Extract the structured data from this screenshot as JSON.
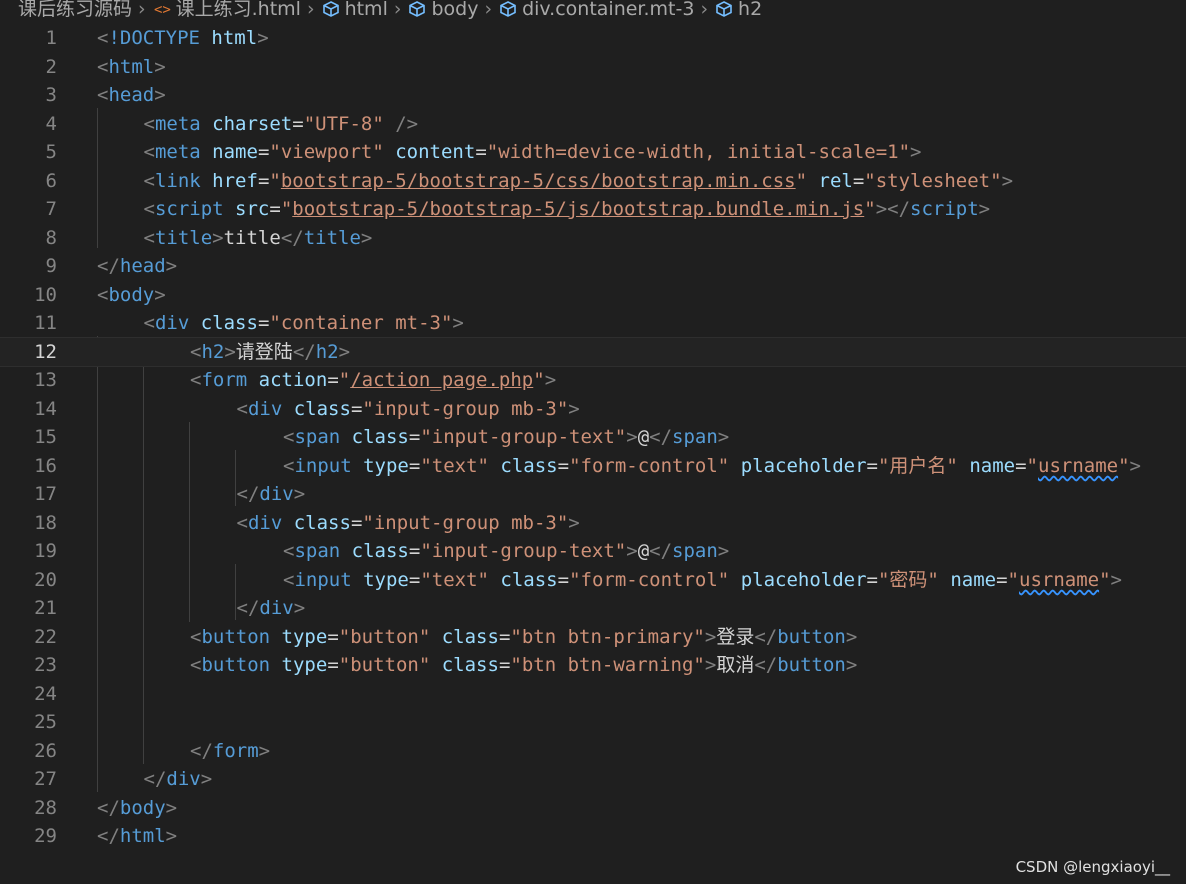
{
  "breadcrumb": [
    {
      "label": "课后练习源码",
      "icon": ""
    },
    {
      "label": "课上练习.html",
      "icon": "html-file-icon"
    },
    {
      "label": "html",
      "icon": "symbol-element-icon"
    },
    {
      "label": "body",
      "icon": "symbol-element-icon"
    },
    {
      "label": "div.container.mt-3",
      "icon": "symbol-element-icon"
    },
    {
      "label": "h2",
      "icon": "symbol-element-icon"
    }
  ],
  "editor": {
    "active_line": 12,
    "lines": [
      {
        "n": "1",
        "indent": 0,
        "tokens": [
          [
            "b",
            "<"
          ],
          [
            "t",
            "!DOCTYPE"
          ],
          [
            "x",
            " "
          ],
          [
            "a",
            "html"
          ],
          [
            "b",
            ">"
          ]
        ]
      },
      {
        "n": "2",
        "indent": 0,
        "tokens": [
          [
            "b",
            "<"
          ],
          [
            "t",
            "html"
          ],
          [
            "b",
            ">"
          ]
        ]
      },
      {
        "n": "3",
        "indent": 0,
        "tokens": [
          [
            "b",
            "<"
          ],
          [
            "t",
            "head"
          ],
          [
            "b",
            ">"
          ]
        ]
      },
      {
        "n": "4",
        "indent": 1,
        "tokens": [
          [
            "b",
            "<"
          ],
          [
            "t",
            "meta"
          ],
          [
            "x",
            " "
          ],
          [
            "a",
            "charset"
          ],
          [
            "x",
            "="
          ],
          [
            "s",
            "\"UTF-8\""
          ],
          [
            "x",
            " "
          ],
          [
            "b",
            "/>"
          ]
        ]
      },
      {
        "n": "5",
        "indent": 1,
        "tokens": [
          [
            "b",
            "<"
          ],
          [
            "t",
            "meta"
          ],
          [
            "x",
            " "
          ],
          [
            "a",
            "name"
          ],
          [
            "x",
            "="
          ],
          [
            "s",
            "\"viewport\""
          ],
          [
            "x",
            " "
          ],
          [
            "a",
            "content"
          ],
          [
            "x",
            "="
          ],
          [
            "s",
            "\"width=device-width, initial-scale=1\""
          ],
          [
            "b",
            ">"
          ]
        ]
      },
      {
        "n": "6",
        "indent": 1,
        "tokens": [
          [
            "b",
            "<"
          ],
          [
            "t",
            "link"
          ],
          [
            "x",
            " "
          ],
          [
            "a",
            "href"
          ],
          [
            "x",
            "="
          ],
          [
            "s",
            "\""
          ],
          [
            "sl",
            "bootstrap-5/bootstrap-5/css/bootstrap.min.css"
          ],
          [
            "s",
            "\""
          ],
          [
            "x",
            " "
          ],
          [
            "a",
            "rel"
          ],
          [
            "x",
            "="
          ],
          [
            "s",
            "\"stylesheet\""
          ],
          [
            "b",
            ">"
          ]
        ]
      },
      {
        "n": "7",
        "indent": 1,
        "tokens": [
          [
            "b",
            "<"
          ],
          [
            "t",
            "script"
          ],
          [
            "x",
            " "
          ],
          [
            "a",
            "src"
          ],
          [
            "x",
            "="
          ],
          [
            "s",
            "\""
          ],
          [
            "sl",
            "bootstrap-5/bootstrap-5/js/bootstrap.bundle.min.js"
          ],
          [
            "s",
            "\""
          ],
          [
            "b",
            "></"
          ],
          [
            "t",
            "script"
          ],
          [
            "b",
            ">"
          ]
        ]
      },
      {
        "n": "8",
        "indent": 1,
        "tokens": [
          [
            "b",
            "<"
          ],
          [
            "t",
            "title"
          ],
          [
            "b",
            ">"
          ],
          [
            "x",
            "title"
          ],
          [
            "b",
            "</"
          ],
          [
            "t",
            "title"
          ],
          [
            "b",
            ">"
          ]
        ]
      },
      {
        "n": "9",
        "indent": 0,
        "tokens": [
          [
            "b",
            "</"
          ],
          [
            "t",
            "head"
          ],
          [
            "b",
            ">"
          ]
        ]
      },
      {
        "n": "10",
        "indent": 0,
        "tokens": [
          [
            "b",
            "<"
          ],
          [
            "t",
            "body"
          ],
          [
            "b",
            ">"
          ]
        ]
      },
      {
        "n": "11",
        "indent": 1,
        "tokens": [
          [
            "b",
            "<"
          ],
          [
            "t",
            "div"
          ],
          [
            "x",
            " "
          ],
          [
            "a",
            "class"
          ],
          [
            "x",
            "="
          ],
          [
            "s",
            "\"container mt-3\""
          ],
          [
            "b",
            ">"
          ]
        ]
      },
      {
        "n": "12",
        "indent": 2,
        "tokens": [
          [
            "b",
            "<"
          ],
          [
            "t",
            "h2"
          ],
          [
            "b",
            ">"
          ],
          [
            "x",
            "请登陆"
          ],
          [
            "b",
            "</"
          ],
          [
            "t",
            "h2"
          ],
          [
            "b",
            ">"
          ]
        ]
      },
      {
        "n": "13",
        "indent": 2,
        "tokens": [
          [
            "b",
            "<"
          ],
          [
            "t",
            "form"
          ],
          [
            "x",
            " "
          ],
          [
            "a",
            "action"
          ],
          [
            "x",
            "="
          ],
          [
            "s",
            "\""
          ],
          [
            "sl",
            "/action_page.php"
          ],
          [
            "s",
            "\""
          ],
          [
            "b",
            ">"
          ]
        ]
      },
      {
        "n": "14",
        "indent": 3,
        "tokens": [
          [
            "b",
            "<"
          ],
          [
            "t",
            "div"
          ],
          [
            "x",
            " "
          ],
          [
            "a",
            "class"
          ],
          [
            "x",
            "="
          ],
          [
            "s",
            "\"input-group mb-3\""
          ],
          [
            "b",
            ">"
          ]
        ]
      },
      {
        "n": "15",
        "indent": 4,
        "tokens": [
          [
            "b",
            "<"
          ],
          [
            "t",
            "span"
          ],
          [
            "x",
            " "
          ],
          [
            "a",
            "class"
          ],
          [
            "x",
            "="
          ],
          [
            "s",
            "\"input-group-text\""
          ],
          [
            "b",
            ">"
          ],
          [
            "x",
            "@"
          ],
          [
            "b",
            "</"
          ],
          [
            "t",
            "span"
          ],
          [
            "b",
            ">"
          ]
        ]
      },
      {
        "n": "16",
        "indent": 4,
        "tokens": [
          [
            "b",
            "<"
          ],
          [
            "t",
            "input"
          ],
          [
            "x",
            " "
          ],
          [
            "a",
            "type"
          ],
          [
            "x",
            "="
          ],
          [
            "s",
            "\"text\""
          ],
          [
            "x",
            " "
          ],
          [
            "a",
            "class"
          ],
          [
            "x",
            "="
          ],
          [
            "s",
            "\"form-control\""
          ],
          [
            "x",
            " "
          ],
          [
            "a",
            "placeholder"
          ],
          [
            "x",
            "="
          ],
          [
            "s",
            "\"用户名\""
          ],
          [
            "x",
            " "
          ],
          [
            "a",
            "name"
          ],
          [
            "x",
            "="
          ],
          [
            "s",
            "\""
          ],
          [
            "sw",
            "usrname"
          ],
          [
            "s",
            "\""
          ],
          [
            "b",
            ">"
          ]
        ]
      },
      {
        "n": "17",
        "indent": 3,
        "tokens": [
          [
            "b",
            "</"
          ],
          [
            "t",
            "div"
          ],
          [
            "b",
            ">"
          ]
        ]
      },
      {
        "n": "18",
        "indent": 3,
        "tokens": [
          [
            "b",
            "<"
          ],
          [
            "t",
            "div"
          ],
          [
            "x",
            " "
          ],
          [
            "a",
            "class"
          ],
          [
            "x",
            "="
          ],
          [
            "s",
            "\"input-group mb-3\""
          ],
          [
            "b",
            ">"
          ]
        ]
      },
      {
        "n": "19",
        "indent": 4,
        "tokens": [
          [
            "b",
            "<"
          ],
          [
            "t",
            "span"
          ],
          [
            "x",
            " "
          ],
          [
            "a",
            "class"
          ],
          [
            "x",
            "="
          ],
          [
            "s",
            "\"input-group-text\""
          ],
          [
            "b",
            ">"
          ],
          [
            "x",
            "@"
          ],
          [
            "b",
            "</"
          ],
          [
            "t",
            "span"
          ],
          [
            "b",
            ">"
          ]
        ]
      },
      {
        "n": "20",
        "indent": 4,
        "tokens": [
          [
            "b",
            "<"
          ],
          [
            "t",
            "input"
          ],
          [
            "x",
            " "
          ],
          [
            "a",
            "type"
          ],
          [
            "x",
            "="
          ],
          [
            "s",
            "\"text\""
          ],
          [
            "x",
            " "
          ],
          [
            "a",
            "class"
          ],
          [
            "x",
            "="
          ],
          [
            "s",
            "\"form-control\""
          ],
          [
            "x",
            " "
          ],
          [
            "a",
            "placeholder"
          ],
          [
            "x",
            "="
          ],
          [
            "s",
            "\"密码\""
          ],
          [
            "x",
            " "
          ],
          [
            "a",
            "name"
          ],
          [
            "x",
            "="
          ],
          [
            "s",
            "\""
          ],
          [
            "sw",
            "usrname"
          ],
          [
            "s",
            "\""
          ],
          [
            "b",
            ">"
          ]
        ]
      },
      {
        "n": "21",
        "indent": 3,
        "tokens": [
          [
            "b",
            "</"
          ],
          [
            "t",
            "div"
          ],
          [
            "b",
            ">"
          ]
        ]
      },
      {
        "n": "22",
        "indent": 2,
        "tokens": [
          [
            "b",
            "<"
          ],
          [
            "t",
            "button"
          ],
          [
            "x",
            " "
          ],
          [
            "a",
            "type"
          ],
          [
            "x",
            "="
          ],
          [
            "s",
            "\"button\""
          ],
          [
            "x",
            " "
          ],
          [
            "a",
            "class"
          ],
          [
            "x",
            "="
          ],
          [
            "s",
            "\"btn btn-primary\""
          ],
          [
            "b",
            ">"
          ],
          [
            "x",
            "登录"
          ],
          [
            "b",
            "</"
          ],
          [
            "t",
            "button"
          ],
          [
            "b",
            ">"
          ]
        ]
      },
      {
        "n": "23",
        "indent": 2,
        "tokens": [
          [
            "b",
            "<"
          ],
          [
            "t",
            "button"
          ],
          [
            "x",
            " "
          ],
          [
            "a",
            "type"
          ],
          [
            "x",
            "="
          ],
          [
            "s",
            "\"button\""
          ],
          [
            "x",
            " "
          ],
          [
            "a",
            "class"
          ],
          [
            "x",
            "="
          ],
          [
            "s",
            "\"btn btn-warning\""
          ],
          [
            "b",
            ">"
          ],
          [
            "x",
            "取消"
          ],
          [
            "b",
            "</"
          ],
          [
            "t",
            "button"
          ],
          [
            "b",
            ">"
          ]
        ]
      },
      {
        "n": "24",
        "indent": 0,
        "tokens": []
      },
      {
        "n": "25",
        "indent": 0,
        "tokens": []
      },
      {
        "n": "26",
        "indent": 2,
        "tokens": [
          [
            "b",
            "</"
          ],
          [
            "t",
            "form"
          ],
          [
            "b",
            ">"
          ]
        ]
      },
      {
        "n": "27",
        "indent": 1,
        "tokens": [
          [
            "b",
            "</"
          ],
          [
            "t",
            "div"
          ],
          [
            "b",
            ">"
          ]
        ]
      },
      {
        "n": "28",
        "indent": 0,
        "tokens": [
          [
            "b",
            "</"
          ],
          [
            "t",
            "body"
          ],
          [
            "b",
            ">"
          ]
        ]
      },
      {
        "n": "29",
        "indent": 0,
        "tokens": [
          [
            "b",
            "</"
          ],
          [
            "t",
            "html"
          ],
          [
            "b",
            ">"
          ]
        ]
      }
    ]
  },
  "watermark": "CSDN @lengxiaoyi__",
  "colors": {
    "background": "#1f1f1f",
    "tag": "#569cd6",
    "attribute": "#9cdcfe",
    "string": "#ce9178",
    "bracket": "#808080",
    "text": "#d4d4d4",
    "line_number": "#858585"
  }
}
